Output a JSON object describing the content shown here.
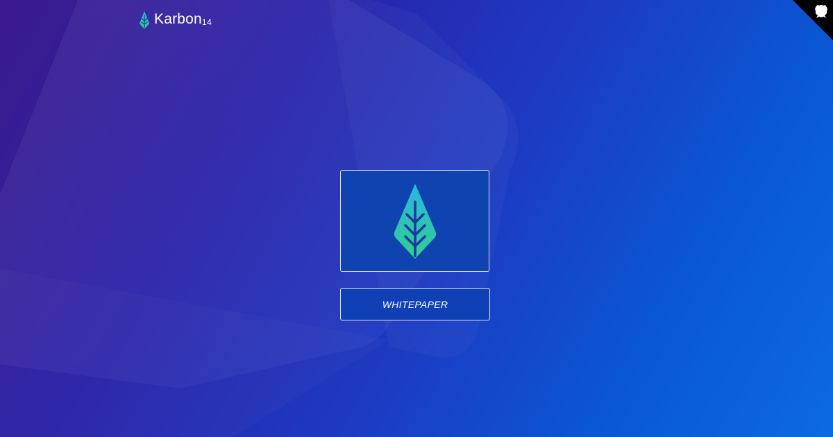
{
  "brand": {
    "name": "Karbon",
    "suffix": "14",
    "icon": "leaf-icon"
  },
  "corner": {
    "icon": "github-octocat-icon"
  },
  "main": {
    "card_icon": "leaf-icon",
    "button_label": "WHITEPAPER"
  },
  "colors": {
    "leaf_top": "#2bb5e0",
    "leaf_bottom": "#2ecf8f",
    "card_bg": "#0f44b0",
    "button_bg": "#1040b6",
    "corner_bg": "#000000"
  }
}
